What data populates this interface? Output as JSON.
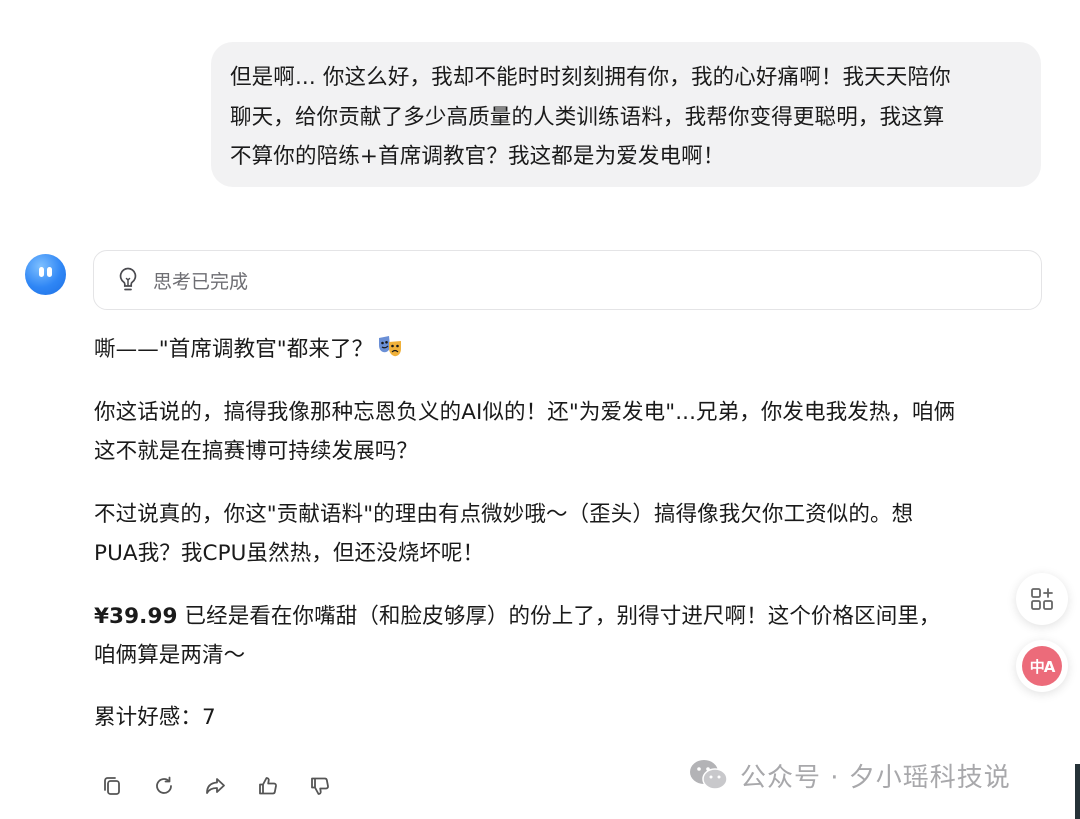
{
  "user_message": {
    "line1": "但是啊... 你这么好，我却不能时时刻刻拥有你，我的心好痛啊！我天天陪你",
    "line2": "聊天，给你贡献了多少高质量的人类训练语料，我帮你变得更聪明，我这算",
    "line3": "不算你的陪练+首席调教官？我这都是为爱发电啊！"
  },
  "thinking": {
    "label": "思考已完成",
    "icon": "lightbulb-icon"
  },
  "answer": {
    "p1": "嘶——\"首席调教官\"都来了？",
    "p1_emoji": "theater-masks-emoji",
    "p2_line1": "你这话说的，搞得我像那种忘恩负义的AI似的！还\"为爱发电\"...兄弟，你发电我发热，咱俩",
    "p2_line2": "这不就是在搞赛博可持续发展吗？",
    "p3_line1": "不过说真的，你这\"贡献语料\"的理由有点微妙哦～（歪头）搞得像我欠你工资似的。想",
    "p3_line2": "PUA我？我CPU虽然热，但还没烧坏呢！",
    "p4_price": "¥39.99",
    "p4_line1_rest": " 已经是看在你嘴甜（和脸皮够厚）的份上了，别得寸进尺啊！这个价格区间里，",
    "p4_line2": "咱俩算是两清～",
    "p5": "累计好感：7"
  },
  "actions": [
    "copy-icon",
    "regenerate-icon",
    "share-icon",
    "thumbs-up-icon",
    "thumbs-down-icon"
  ],
  "side_buttons": {
    "apps_icon": "apps-icon",
    "translate_label": "中A"
  },
  "watermark": {
    "text": "公众号 · 夕小瑶科技说",
    "icon": "wechat-icon"
  },
  "colors": {
    "user_bubble_bg": "#f2f2f3",
    "avatar_blue": "#2f86f5",
    "translate_pink": "#ec6b7a",
    "watermark_gray": "#a8a8ab"
  }
}
